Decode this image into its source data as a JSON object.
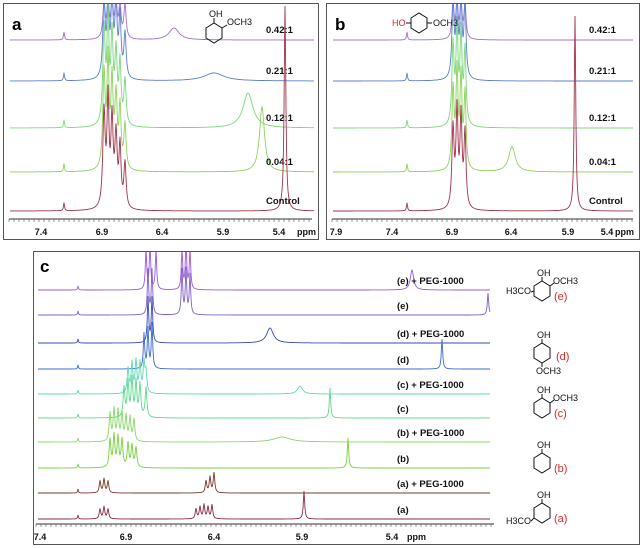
{
  "panels": {
    "a": {
      "letter": "a",
      "axis_unit": "ppm",
      "ticks": [
        "7.4",
        "6.9",
        "6.4",
        "5.9",
        "5.4"
      ],
      "traces": [
        {
          "label": "0.42:1",
          "color": "#a070d0"
        },
        {
          "label": "0.21:1",
          "color": "#5a7fd0"
        },
        {
          "label": "0.12:1",
          "color": "#7bd87b"
        },
        {
          "label": "0.04:1",
          "color": "#8fd15a"
        },
        {
          "label": "Control",
          "color": "#a0324a"
        }
      ],
      "molecule": {
        "oh": "OH",
        "sub": "OCH3"
      }
    },
    "b": {
      "letter": "b",
      "axis_unit": "ppm",
      "ticks": [
        "7.9",
        "7.4",
        "6.9",
        "6.4",
        "5.9",
        "5.4"
      ],
      "traces": [
        {
          "label": "0.42:1",
          "color": "#a070d0"
        },
        {
          "label": "0.21:1",
          "color": "#5a7fd0"
        },
        {
          "label": "0.12:1",
          "color": "#7bd87b"
        },
        {
          "label": "0.04:1",
          "color": "#8fd15a"
        },
        {
          "label": "Control",
          "color": "#a0324a"
        }
      ],
      "molecule": {
        "oh": "HO",
        "sub": "OCH3"
      }
    },
    "c": {
      "letter": "c",
      "axis_unit": "ppm",
      "ticks": [
        "7.4",
        "6.9",
        "6.4",
        "5.9",
        "5.4"
      ],
      "traces": [
        {
          "label": "(e) + PEG-1000",
          "color": "#9a5ad6"
        },
        {
          "label": "(e)",
          "color": "#8060c8"
        },
        {
          "label": "(d) + PEG-1000",
          "color": "#3a4ab0"
        },
        {
          "label": "(d)",
          "color": "#3a6ad0"
        },
        {
          "label": "(c) + PEG-1000",
          "color": "#5ed8b0"
        },
        {
          "label": "(c)",
          "color": "#60d890"
        },
        {
          "label": "(b) + PEG-1000",
          "color": "#8ad86a"
        },
        {
          "label": "(b)",
          "color": "#7ad040"
        },
        {
          "label": "(a) + PEG-1000",
          "color": "#7a3a2a"
        },
        {
          "label": "(a)",
          "color": "#8a2a50"
        }
      ],
      "legend": [
        {
          "tag": "(e)",
          "groups": [
            "H3CO",
            "OH",
            "OCH3"
          ]
        },
        {
          "tag": "(d)",
          "groups": [
            "OH",
            "OCH3"
          ]
        },
        {
          "tag": "(c)",
          "groups": [
            "OH",
            "OCH3"
          ]
        },
        {
          "tag": "(b)",
          "groups": [
            "OH"
          ]
        },
        {
          "tag": "(a)",
          "groups": [
            "OH",
            "H3CO"
          ]
        }
      ]
    }
  },
  "colors": {
    "frame": "#555555",
    "label_red": "#d42a2a"
  }
}
